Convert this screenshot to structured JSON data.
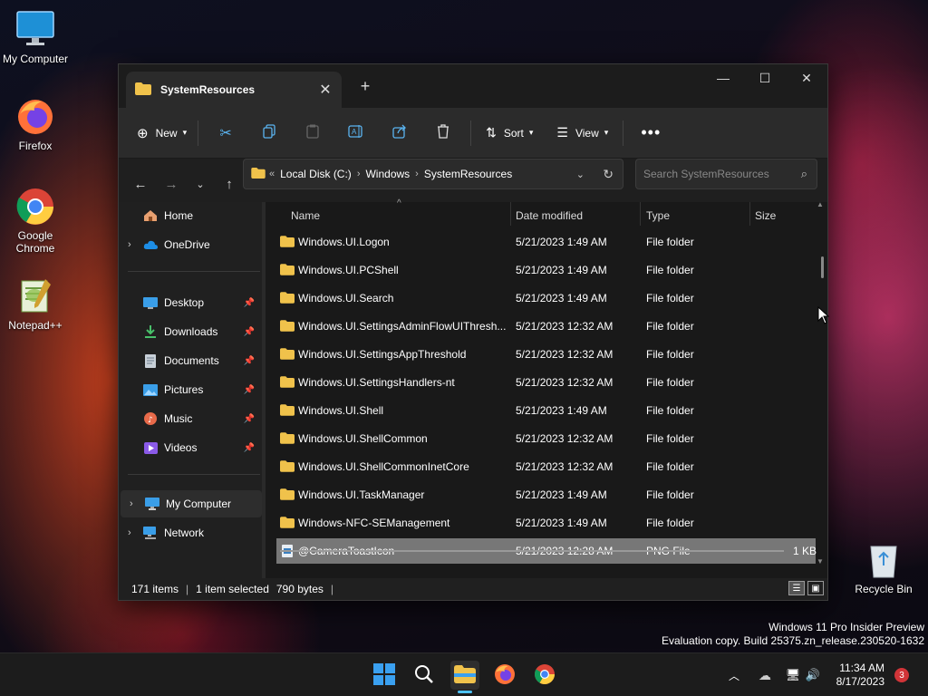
{
  "desktop": {
    "icons": [
      {
        "label": "My Computer",
        "icon": "monitor-icon"
      },
      {
        "label": "Firefox",
        "icon": "firefox-icon"
      },
      {
        "label": "Google Chrome",
        "icon": "chrome-icon"
      },
      {
        "label": "Notepad++",
        "icon": "notepadpp-icon"
      }
    ],
    "recycle_bin": "Recycle Bin"
  },
  "window": {
    "tab_title": "SystemResources",
    "toolbar": {
      "new_label": "New",
      "sort_label": "Sort",
      "view_label": "View"
    },
    "address": {
      "crumbs": [
        "Local Disk (C:)",
        "Windows",
        "SystemResources"
      ]
    },
    "search": {
      "placeholder": "Search SystemResources"
    },
    "nav": {
      "home": "Home",
      "onedrive": "OneDrive",
      "quick": [
        "Desktop",
        "Downloads",
        "Documents",
        "Pictures",
        "Music",
        "Videos"
      ],
      "my_computer": "My Computer",
      "network": "Network"
    },
    "columns": {
      "name": "Name",
      "date": "Date modified",
      "type": "Type",
      "size": "Size"
    },
    "rows": [
      {
        "name": "Windows.UI.Logon",
        "date": "5/21/2023 1:49 AM",
        "type": "File folder",
        "size": ""
      },
      {
        "name": "Windows.UI.PCShell",
        "date": "5/21/2023 1:49 AM",
        "type": "File folder",
        "size": ""
      },
      {
        "name": "Windows.UI.Search",
        "date": "5/21/2023 1:49 AM",
        "type": "File folder",
        "size": ""
      },
      {
        "name": "Windows.UI.SettingsAdminFlowUIThresh...",
        "date": "5/21/2023 12:32 AM",
        "type": "File folder",
        "size": ""
      },
      {
        "name": "Windows.UI.SettingsAppThreshold",
        "date": "5/21/2023 12:32 AM",
        "type": "File folder",
        "size": ""
      },
      {
        "name": "Windows.UI.SettingsHandlers-nt",
        "date": "5/21/2023 12:32 AM",
        "type": "File folder",
        "size": ""
      },
      {
        "name": "Windows.UI.Shell",
        "date": "5/21/2023 1:49 AM",
        "type": "File folder",
        "size": ""
      },
      {
        "name": "Windows.UI.ShellCommon",
        "date": "5/21/2023 12:32 AM",
        "type": "File folder",
        "size": ""
      },
      {
        "name": "Windows.UI.ShellCommonInetCore",
        "date": "5/21/2023 12:32 AM",
        "type": "File folder",
        "size": ""
      },
      {
        "name": "Windows.UI.TaskManager",
        "date": "5/21/2023 1:49 AM",
        "type": "File folder",
        "size": ""
      },
      {
        "name": "Windows-NFC-SEManagement",
        "date": "5/21/2023 1:49 AM",
        "type": "File folder",
        "size": ""
      },
      {
        "name": "@CameraToastIcon",
        "date": "5/21/2023 12:28 AM",
        "type": "PNG File",
        "size": "1 KB"
      }
    ],
    "status": {
      "items": "171 items",
      "selected": "1 item selected",
      "bytes": "790 bytes"
    }
  },
  "watermark": {
    "line1": "Windows 11 Pro Insider Preview",
    "line2": "Evaluation copy. Build 25375.zn_release.230520-1632"
  },
  "taskbar": {
    "time": "11:34 AM",
    "date": "8/17/2023",
    "notification_count": "3"
  },
  "colors": {
    "accent": "#4cc2ff",
    "folder": "#f0c24b",
    "selected_row": "#777777"
  }
}
